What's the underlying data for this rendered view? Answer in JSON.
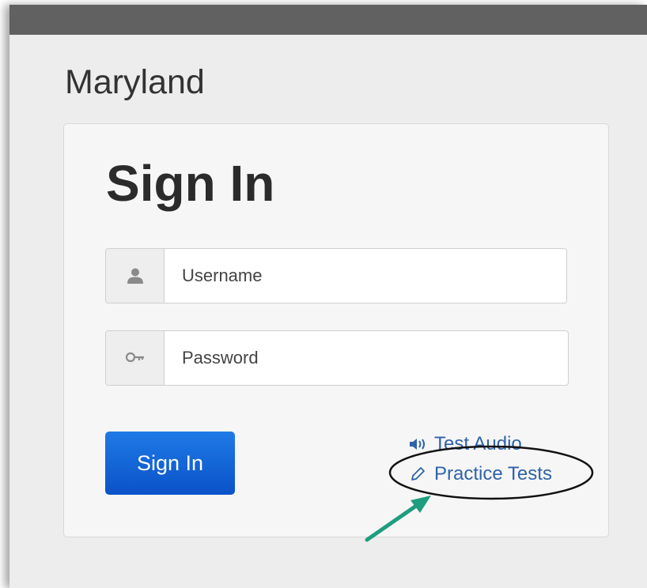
{
  "header": {
    "state_name": "Maryland"
  },
  "signin": {
    "title": "Sign In",
    "username": {
      "placeholder": "Username",
      "value": ""
    },
    "password": {
      "placeholder": "Password",
      "value": ""
    },
    "button_label": "Sign In"
  },
  "links": {
    "test_audio": "Test Audio",
    "practice_tests": "Practice Tests"
  },
  "colors": {
    "top_bar": "#616161",
    "button": "#0a52c8",
    "link": "#2f63a8",
    "annotation_arrow": "#1f9e7f"
  },
  "icons": {
    "username": "user-icon",
    "password": "key-icon",
    "audio": "speaker-icon",
    "practice": "pencil-icon"
  }
}
